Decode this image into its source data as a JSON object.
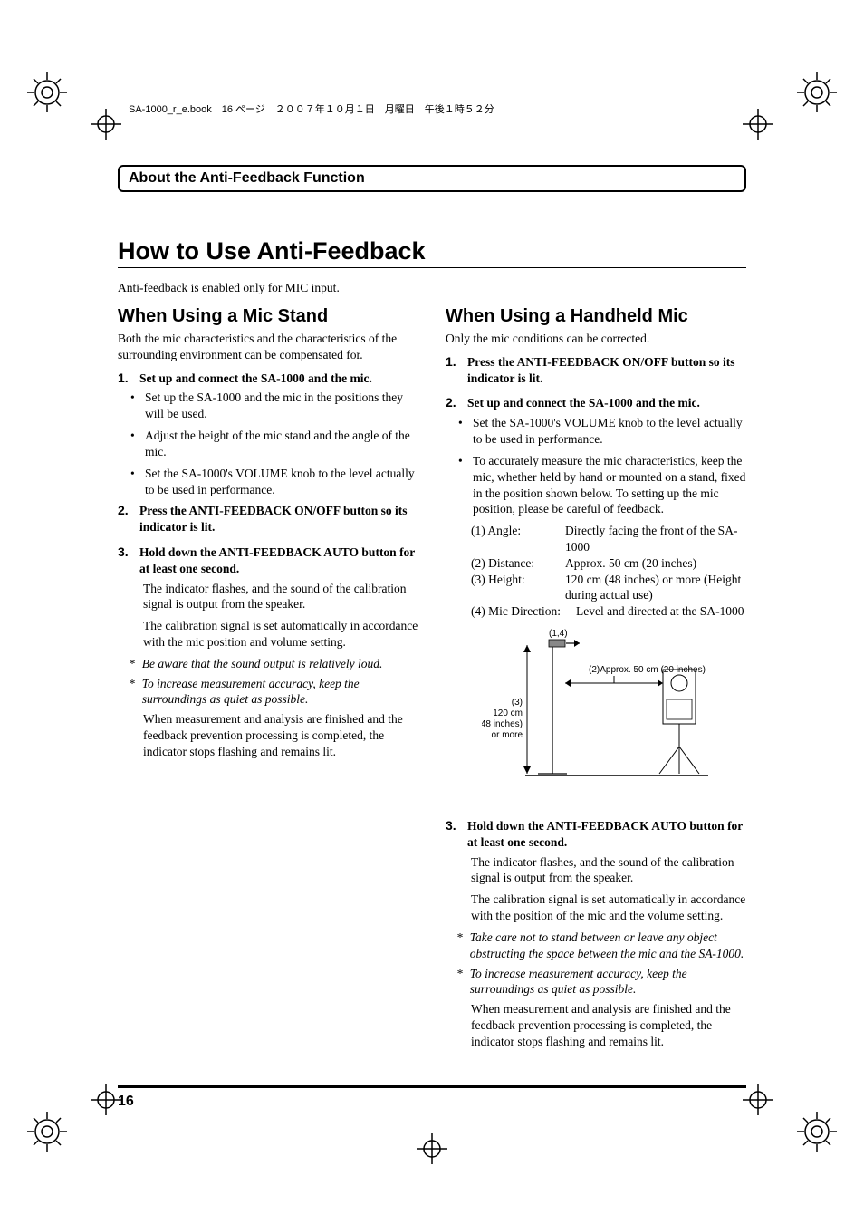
{
  "header_line": "SA-1000_r_e.book　16 ページ　２００７年１０月１日　月曜日　午後１時５２分",
  "title_box": "About the Anti-Feedback Function",
  "h1": "How to Use Anti-Feedback",
  "intro": "Anti-feedback is enabled only for MIC input.",
  "left": {
    "h2": "When Using a Mic Stand",
    "intro": "Both the mic characteristics and the characteristics of the surrounding environment can be compensated for.",
    "step1": {
      "num": "1.",
      "head": "Set up and connect the SA-1000 and the mic."
    },
    "b1": "Set up the SA-1000 and the mic in the positions they will be used.",
    "b2": "Adjust the height of the mic stand and the angle of the mic.",
    "b3": "Set the SA-1000's VOLUME knob to the level actually to be used in performance.",
    "step2": {
      "num": "2.",
      "head": "Press the ANTI-FEEDBACK ON/OFF button so its indicator is lit."
    },
    "step3": {
      "num": "3.",
      "head": "Hold down the ANTI-FEEDBACK AUTO button for at least one second."
    },
    "p3a": "The indicator flashes, and the sound of the calibration signal is output from the speaker.",
    "p3b": "The calibration signal is set automatically in accordance with the mic position and volume setting.",
    "n1": "Be aware that the sound output is relatively loud.",
    "n2": "To increase measurement accuracy, keep the surroundings as quiet as possible.",
    "p3c": "When measurement and analysis are finished and the feedback prevention processing is completed, the indicator stops flashing and remains lit."
  },
  "right": {
    "h2": "When Using a Handheld Mic",
    "intro": "Only the mic conditions can be corrected.",
    "step1": {
      "num": "1.",
      "head": "Press the ANTI-FEEDBACK ON/OFF button so its indicator is lit."
    },
    "step2": {
      "num": "2.",
      "head": "Set up and connect the SA-1000 and the mic."
    },
    "b1": "Set the SA-1000's VOLUME knob to the level actually to be used in performance.",
    "b2": "To accurately measure the mic characteristics, keep the mic, whether held by hand or mounted on a stand, fixed in the position shown below. To setting up the mic position, please be careful of feedback.",
    "spec1": {
      "label": "(1) Angle:",
      "val": "Directly facing the front of the SA-1000"
    },
    "spec2": {
      "label": "(2) Distance:",
      "val": "Approx. 50 cm (20 inches)"
    },
    "spec3": {
      "label": "(3) Height:",
      "val": "120 cm (48 inches) or more (Height during actual use)"
    },
    "spec4": {
      "label": "(4) Mic Direction:",
      "val": "Level and directed at the SA-1000"
    },
    "diagram": {
      "label14": "(1,4)",
      "label2": "(2)Approx. 50 cm (20 inches)",
      "label3a": "(3)",
      "label3b": "120 cm",
      "label3c": "(48 inches)",
      "label3d": "or more"
    },
    "step3": {
      "num": "3.",
      "head": "Hold down the ANTI-FEEDBACK AUTO button for at least one second."
    },
    "p3a": "The indicator flashes, and the sound of the calibration signal is output from the speaker.",
    "p3b": "The calibration signal is set automatically in accordance with the position of the mic and the volume setting.",
    "n1": "Take care not to stand between or leave any object obstructing the space between the mic and the SA-1000.",
    "n2": "To increase measurement accuracy, keep the surroundings as quiet as possible.",
    "p3c": "When measurement and analysis are finished and the feedback prevention processing is completed, the indicator stops flashing and remains lit."
  },
  "page_number": "16"
}
